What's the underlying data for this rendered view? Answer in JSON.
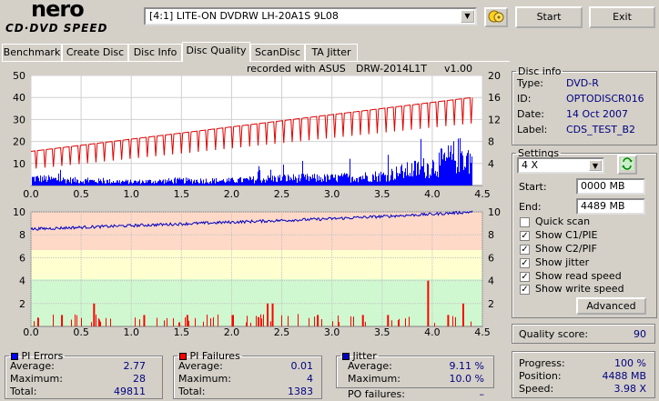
{
  "logo": {
    "brand": "nero",
    "product": "CD·DVD SPEED"
  },
  "drive": {
    "value": "[4:1]  LITE-ON DVDRW LH-20A1S 9L08"
  },
  "buttons": {
    "start": "Start",
    "exit": "Exit",
    "advanced": "Advanced"
  },
  "tabs": [
    "Benchmark",
    "Create Disc",
    "Disc Info",
    "Disc Quality",
    "ScanDisc",
    "TA Jitter"
  ],
  "active_tab": "Disc Quality",
  "chart_header": {
    "left": "recorded with ASUS",
    "mid": "DRW-2014L1T",
    "right": "v1.00"
  },
  "disc_info": {
    "title": "Disc info",
    "type_label": "Type:",
    "type": "DVD-R",
    "id_label": "ID:",
    "id": "OPTODISCR016",
    "date_label": "Date:",
    "date": "14 Oct 2007",
    "label_label": "Label:",
    "label": "CDS_TEST_B2"
  },
  "settings": {
    "title": "Settings",
    "speed": "4 X",
    "start_label": "Start:",
    "start": "0000 MB",
    "end_label": "End:",
    "end": "4489 MB",
    "options": [
      {
        "label": "Quick scan",
        "checked": false
      },
      {
        "label": "Show C1/PIE",
        "checked": true
      },
      {
        "label": "Show C2/PIF",
        "checked": true
      },
      {
        "label": "Show jitter",
        "checked": true
      },
      {
        "label": "Show read speed",
        "checked": true
      },
      {
        "label": "Show write speed",
        "checked": true
      }
    ]
  },
  "quality": {
    "label": "Quality score:",
    "value": "90"
  },
  "pi_errors": {
    "title": "PI Errors",
    "avg_label": "Average:",
    "avg": "2.77",
    "max_label": "Maximum:",
    "max": "28",
    "total_label": "Total:",
    "total": "49811"
  },
  "pi_failures": {
    "title": "PI Failures",
    "avg_label": "Average:",
    "avg": "0.01",
    "max_label": "Maximum:",
    "max": "4",
    "total_label": "Total:",
    "total": "1383"
  },
  "jitter": {
    "title": "Jitter",
    "avg_label": "Average:",
    "avg": "9.11 %",
    "max_label": "Maximum:",
    "max": "10.0 %",
    "po_label": "PO failures:",
    "po": "–"
  },
  "progress": {
    "progress_label": "Progress:",
    "progress": "100 %",
    "position_label": "Position:",
    "position": "4488 MB",
    "speed_label": "Speed:",
    "speed": "3.98 X"
  },
  "colors": {
    "pie": "#0000ff",
    "read_speed": "#ff0000",
    "pif": "#ff0000",
    "jitter": "#0000c0",
    "band_red": "#ffd9c8",
    "band_yellow": "#ffffd0",
    "band_green": "#d0f8d0"
  },
  "chart_data": [
    {
      "type": "bar",
      "name": "PI Errors / read speed",
      "x_ticks": [
        "0.0",
        "0.5",
        "1.0",
        "1.5",
        "2.0",
        "2.5",
        "3.0",
        "3.5",
        "4.0",
        "4.5"
      ],
      "y_left_ticks": [
        "10",
        "20",
        "30",
        "40",
        "50"
      ],
      "y_right_ticks": [
        "4",
        "8",
        "12",
        "16",
        "20"
      ],
      "xlim": [
        0,
        4.5
      ],
      "ylim_left": [
        0,
        50
      ],
      "ylim_right": [
        0,
        20
      ],
      "pie_profile_x": [
        0.0,
        0.5,
        1.0,
        1.5,
        2.0,
        2.5,
        3.0,
        3.5,
        4.0,
        4.3,
        4.4
      ],
      "pie_profile_y": [
        3,
        2,
        1.5,
        2,
        2,
        3,
        3,
        4,
        8,
        13,
        10
      ],
      "speed_x": [
        0.0,
        4.4
      ],
      "speed_y": [
        6.2,
        16.0
      ]
    },
    {
      "type": "bar",
      "name": "PI Failures / jitter",
      "x_ticks": [
        "0.0",
        "0.5",
        "1.0",
        "1.5",
        "2.0",
        "2.5",
        "3.0",
        "3.5",
        "4.0",
        "4.5"
      ],
      "y_left_ticks": [
        "2",
        "4",
        "6",
        "8",
        "10"
      ],
      "y_right_ticks": [
        "2",
        "4",
        "6",
        "8",
        "10"
      ],
      "xlim": [
        0,
        4.5
      ],
      "ylim": [
        0,
        10
      ],
      "jitter_x": [
        0.0,
        1.0,
        2.0,
        3.0,
        4.0,
        4.4
      ],
      "jitter_y": [
        8.5,
        8.8,
        9.1,
        9.4,
        9.8,
        10.0
      ],
      "pif_spikes_x": [
        0.3,
        0.62,
        1.12,
        1.55,
        2.0,
        2.35,
        2.4,
        2.85,
        3.3,
        3.55,
        3.95,
        4.15,
        4.3
      ],
      "pif_spikes_y": [
        1,
        2,
        1,
        1,
        1,
        2,
        2,
        1,
        1,
        1,
        4,
        1,
        2
      ]
    }
  ]
}
